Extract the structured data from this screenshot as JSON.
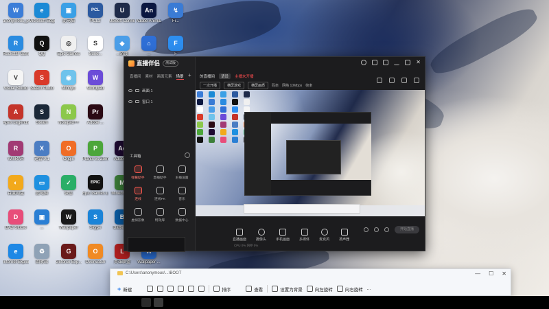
{
  "desktop_icons": [
    {
      "label": "anonymous_p...",
      "color": "#3b7dd8",
      "glyph": "W"
    },
    {
      "label": "Microsoft Edge",
      "color": "#1b8ad6",
      "glyph": "e"
    },
    {
      "label": "此电脑",
      "color": "#3aa0e6",
      "glyph": "▣"
    },
    {
      "label": "PCL2",
      "color": "#2c5aa0",
      "glyph": "PCL"
    },
    {
      "label": "Ubisoft Connect",
      "color": "#1e2b4a",
      "glyph": "U"
    },
    {
      "label": "Adobe Anima...",
      "color": "#0a1740",
      "glyph": "An"
    },
    {
      "label": "Fi...",
      "color": "#3a7bd5",
      "glyph": "↯"
    },
    {
      "label": "Rockstar Games",
      "color": "#2a8be0",
      "glyph": "R"
    },
    {
      "label": "QQ",
      "color": "#111111",
      "glyph": "Q"
    },
    {
      "label": "Epic Games",
      "color": "#f0f0f0",
      "glyph": "◎"
    },
    {
      "label": "Suno...",
      "color": "#ffffff",
      "glyph": "S"
    },
    {
      "label": "...游戏",
      "color": "#4b9ee8",
      "glyph": "◆"
    },
    {
      "label": "...",
      "color": "#2f6fd6",
      "glyph": "⌂"
    },
    {
      "label": "F",
      "color": "#2d8ef0",
      "glyph": "F"
    },
    {
      "label": "Visual Studio",
      "color": "#f5f5f5",
      "glyph": "V"
    },
    {
      "label": "Steam Audio",
      "color": "#d93a2a",
      "glyph": "S"
    },
    {
      "label": "Mihoyo",
      "color": "#6fc3ec",
      "glyph": "◉"
    },
    {
      "label": "Wordpad",
      "color": "#6b4cd8",
      "glyph": "W"
    },
    {
      "label": "Apex Legends",
      "color": "#c4342a",
      "glyph": "A"
    },
    {
      "label": "Steam",
      "color": "#1b2838",
      "glyph": "S"
    },
    {
      "label": "Notepad++",
      "color": "#8cc84b",
      "glyph": "N"
    },
    {
      "label": "Adobe ...",
      "color": "#2b0a14",
      "glyph": "Pr"
    },
    {
      "label": "WinRAR",
      "color": "#a23a74",
      "glyph": "R"
    },
    {
      "label": "迅雷 9.1",
      "color": "#4b7dc3",
      "glyph": "X"
    },
    {
      "label": "Origin",
      "color": "#f06d26",
      "glyph": "O"
    },
    {
      "label": "Plants vs Zombies",
      "color": "#4ca63a",
      "glyph": "P"
    },
    {
      "label": "Adobe ...",
      "color": "#1f0a32",
      "glyph": "Ae"
    },
    {
      "label": "百度网盘",
      "color": "#f2a91c",
      "glyph": "◐"
    },
    {
      "label": "此电脑",
      "color": "#1e90e0",
      "glyph": "▭"
    },
    {
      "label": "微信",
      "color": "#2aae67",
      "glyph": "✓"
    },
    {
      "label": "Epic Games Launcher",
      "color": "#121212",
      "glyph": "EPIC"
    },
    {
      "label": "Minecraft ...",
      "color": "#3c7f3a",
      "glyph": "M"
    },
    {
      "label": "DAZ Studio",
      "color": "#e84d7a",
      "glyph": "D"
    },
    {
      "label": "...",
      "color": "#2a7fd4",
      "glyph": "▣"
    },
    {
      "label": "Wallpaper",
      "color": "#1a1a1a",
      "glyph": "W"
    },
    {
      "label": "Skype",
      "color": "#1b84d8",
      "glyph": "S"
    },
    {
      "label": "Battle.net",
      "color": "#0b5fa8",
      "glyph": "B"
    },
    {
      "label": "Internet Explorer",
      "color": "#1e88e5",
      "glyph": "e"
    },
    {
      "label": "回收站",
      "color": "#8fa2b6",
      "glyph": "♻"
    },
    {
      "label": "Geforce Exp...",
      "color": "#6a1a1a",
      "glyph": "G"
    },
    {
      "label": "Overwatch",
      "color": "#f08a24",
      "glyph": "O"
    },
    {
      "label": "英雄联盟",
      "color": "#b32020",
      "glyph": "L"
    },
    {
      "label": "Wallpaper ...",
      "color": "#2a6fd6",
      "glyph": "W"
    }
  ],
  "app": {
    "name": "直播伴侣",
    "version": "测试版",
    "sidebar_tabs": [
      "直播间",
      "素材",
      "画面元素",
      "场景",
      "+"
    ],
    "scenes": [
      {
        "label": "画面 1"
      },
      {
        "label": "窗口 1"
      }
    ],
    "tools_title": "工具箱",
    "tools": [
      {
        "label": "弹幕助手",
        "red": true
      },
      {
        "label": "直播助手",
        "red": false
      },
      {
        "label": "主播设置",
        "red": false
      },
      {
        "label": "连线",
        "red": true
      },
      {
        "label": "连线PK",
        "red": false
      },
      {
        "label": "音乐",
        "red": false
      },
      {
        "label": "虚拟形象",
        "red": false
      },
      {
        "label": "特效库",
        "red": false
      },
      {
        "label": "数据中心",
        "red": false
      }
    ],
    "room": {
      "title": "的直播间",
      "tag": "请设",
      "warning": "主播未开播",
      "category_label": "一次开播",
      "category_button": "横屏游戏",
      "resolution": "横屏画质",
      "bitrate_label": "码率",
      "network": "网络 10Mbps",
      "fps": "帧率"
    },
    "controls": [
      {
        "label": "直播画面",
        "icon": "screen-share-icon"
      },
      {
        "label": "摄像头",
        "icon": "camera-icon"
      },
      {
        "label": "手机画面",
        "icon": "phone-icon"
      },
      {
        "label": "多媒体",
        "icon": "media-icon"
      },
      {
        "label": "麦克风",
        "icon": "microphone-icon"
      },
      {
        "label": "扬声器",
        "icon": "speaker-icon"
      }
    ],
    "start_button": "开始直播",
    "status_text": "CPU 0% 内存 0%"
  },
  "explorer": {
    "path": "C:\\Users\\anonymous\\...\\BOOT",
    "new_label": "新建",
    "sort_label": "排序",
    "view_label": "查看",
    "set_bg_label": "设置为背景",
    "rotate_left_label": "向左旋转",
    "rotate_right_label": "向右旋转",
    "more_label": "..."
  }
}
